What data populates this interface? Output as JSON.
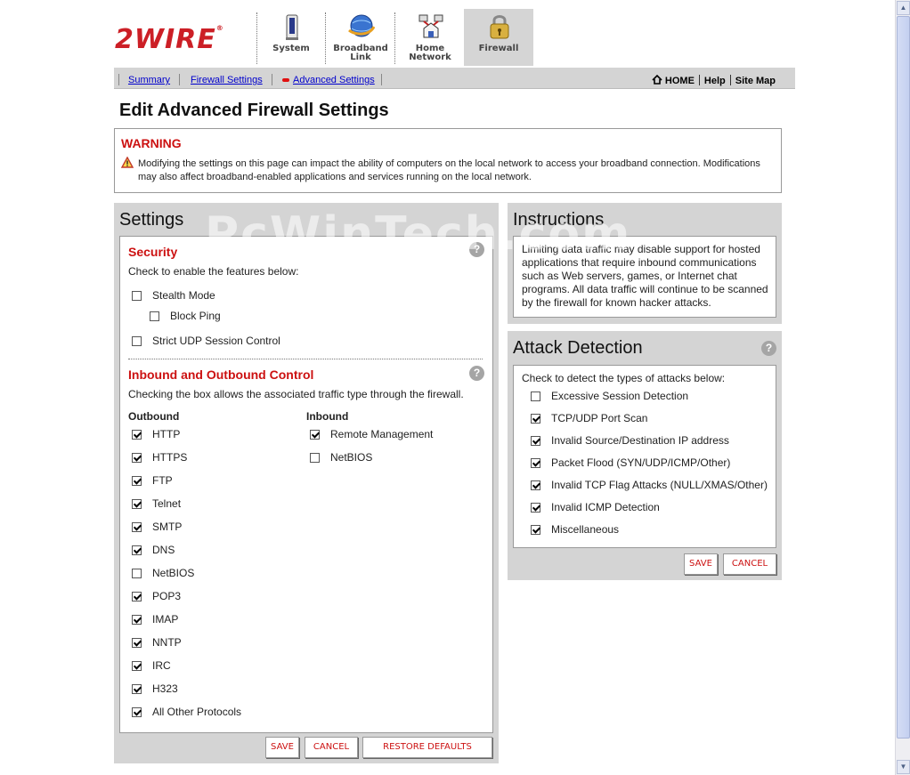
{
  "brand": {
    "logo_text": "2WIRE",
    "logo_mark": "®",
    "accent": "#cc1f26"
  },
  "nav_tabs": [
    {
      "label_line1": "System",
      "label_line2": "",
      "icon": "modem-icon",
      "active": false
    },
    {
      "label_line1": "Broadband",
      "label_line2": "Link",
      "icon": "globe-icon",
      "active": false
    },
    {
      "label_line1": "Home",
      "label_line2": "Network",
      "icon": "home-network-icon",
      "active": false
    },
    {
      "label_line1": "Firewall",
      "label_line2": "",
      "icon": "padlock-icon",
      "active": true
    }
  ],
  "subnav": {
    "links": [
      "Summary",
      "Firewall Settings",
      "Advanced Settings"
    ],
    "right_links": [
      "HOME",
      "Help",
      "Site Map"
    ]
  },
  "page_title": "Edit Advanced Firewall Settings",
  "warning": {
    "title": "WARNING",
    "text": "Modifying the settings on this page can impact the ability of computers on the local network to access your broadband connection. Modifications may also affect broadband-enabled applications and services running on the local network."
  },
  "settings": {
    "title": "Settings",
    "security": {
      "title": "Security",
      "intro": "Check to enable the features below:",
      "stealth_mode": {
        "label": "Stealth Mode",
        "checked": false
      },
      "block_ping": {
        "label": "Block Ping",
        "checked": false
      },
      "strict_udp": {
        "label": "Strict UDP Session Control",
        "checked": false
      }
    },
    "inout": {
      "title": "Inbound and Outbound Control",
      "intro": "Checking the box allows the associated traffic type through the firewall.",
      "outbound_header": "Outbound",
      "inbound_header": "Inbound",
      "outbound": [
        {
          "label": "HTTP",
          "checked": true
        },
        {
          "label": "HTTPS",
          "checked": true
        },
        {
          "label": "FTP",
          "checked": true
        },
        {
          "label": "Telnet",
          "checked": true
        },
        {
          "label": "SMTP",
          "checked": true
        },
        {
          "label": "DNS",
          "checked": true
        },
        {
          "label": "NetBIOS",
          "checked": false
        },
        {
          "label": "POP3",
          "checked": true
        },
        {
          "label": "IMAP",
          "checked": true
        },
        {
          "label": "NNTP",
          "checked": true
        },
        {
          "label": "IRC",
          "checked": true
        },
        {
          "label": "H323",
          "checked": true
        },
        {
          "label": "All Other Protocols",
          "checked": true
        }
      ],
      "inbound": [
        {
          "label": "Remote Management",
          "checked": true
        },
        {
          "label": "NetBIOS",
          "checked": false
        }
      ]
    },
    "buttons": {
      "save": "SAVE",
      "cancel": "CANCEL",
      "restore": "RESTORE DEFAULTS"
    }
  },
  "instructions": {
    "title": "Instructions",
    "text": "Limiting data traffic may disable support for hosted applications that require inbound communications such as Web servers, games, or Internet chat programs. All data traffic will continue to be scanned by the firewall for known hacker attacks."
  },
  "attack": {
    "title": "Attack Detection",
    "intro": "Check to detect the types of attacks below:",
    "items": [
      {
        "label": "Excessive Session Detection",
        "checked": false
      },
      {
        "label": "TCP/UDP Port Scan",
        "checked": true
      },
      {
        "label": "Invalid Source/Destination IP address",
        "checked": true
      },
      {
        "label": "Packet Flood (SYN/UDP/ICMP/Other)",
        "checked": true
      },
      {
        "label": "Invalid TCP Flag Attacks (NULL/XMAS/Other)",
        "checked": true
      },
      {
        "label": "Invalid ICMP Detection",
        "checked": true
      },
      {
        "label": "Miscellaneous",
        "checked": true
      }
    ],
    "buttons": {
      "save": "SAVE",
      "cancel": "CANCEL"
    }
  },
  "help_glyph": "?",
  "watermark": "PcWinTech.com"
}
